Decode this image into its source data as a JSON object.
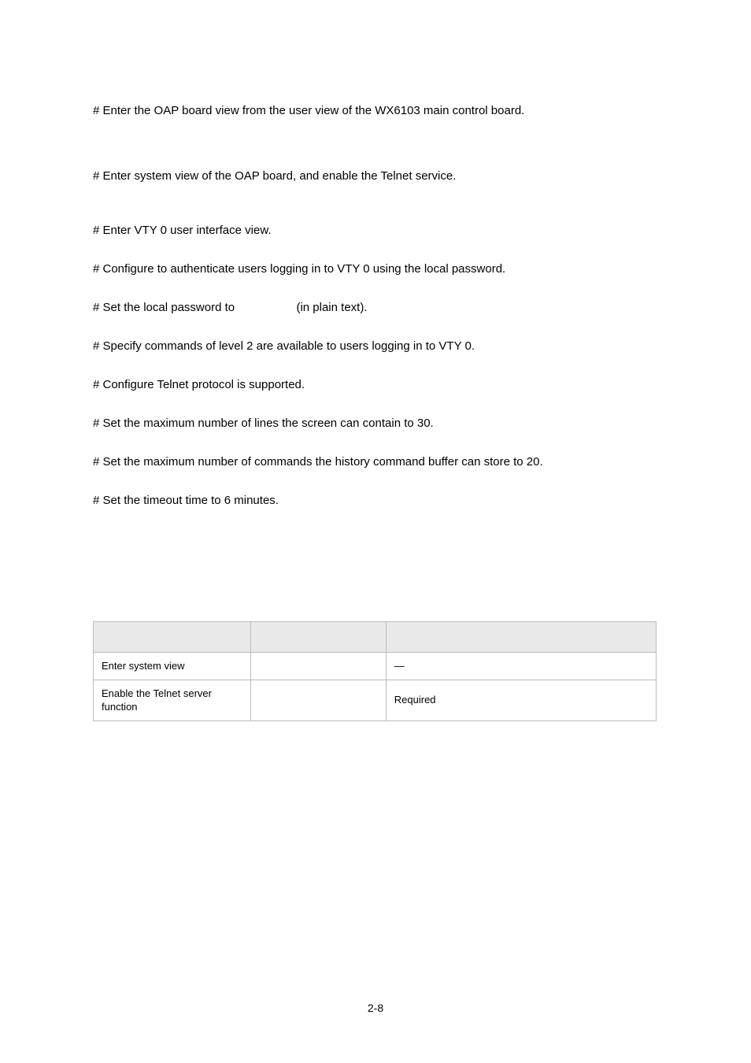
{
  "paragraphs": {
    "p1": "# Enter the OAP board view from the user view of the WX6103 main control board.",
    "p2": "# Enter system view of the OAP board, and enable the Telnet service.",
    "p3": "# Enter VTY 0 user interface view.",
    "p4": "# Configure to authenticate users logging in to VTY 0 using the local password.",
    "p5_a": "# Set the local password to ",
    "p5_b": " (in plain text).",
    "p6": "# Specify commands of level 2 are available to users logging in to VTY 0.",
    "p7": "# Configure Telnet protocol is supported.",
    "p8": "# Set the maximum number of lines the screen can contain to 30.",
    "p9": "# Set the maximum number of commands the history command buffer can store to 20.",
    "p10": "# Set the timeout time to 6 minutes."
  },
  "table": {
    "headers": {
      "c1": "",
      "c2": "",
      "c3": ""
    },
    "rows": [
      {
        "c1": "Enter system view",
        "c2": "",
        "c3": "—"
      },
      {
        "c1": "Enable the Telnet server function",
        "c2": "",
        "c3": "Required"
      }
    ]
  },
  "footer": {
    "page": "2-8"
  }
}
